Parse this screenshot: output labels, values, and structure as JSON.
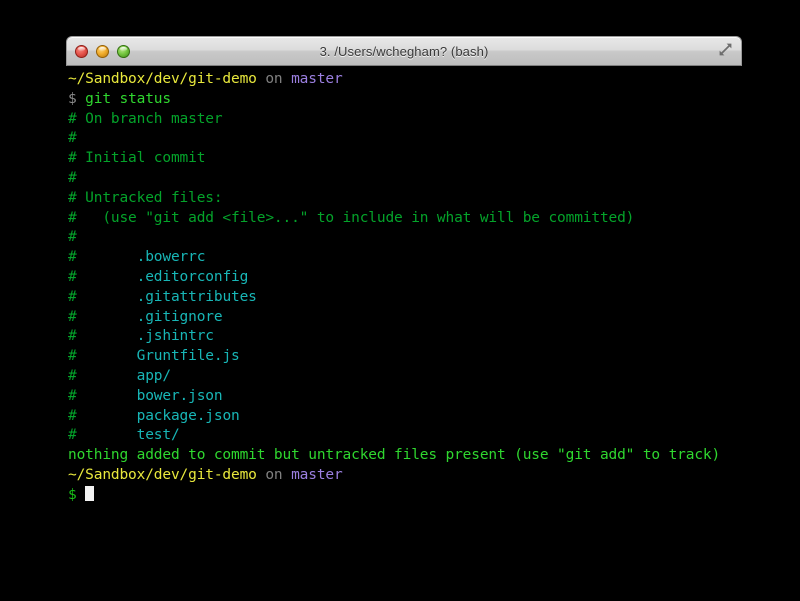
{
  "window": {
    "title": "3. /Users/wchegham? (bash)",
    "traffic_lights": [
      {
        "name": "close",
        "color": "#e8584f"
      },
      {
        "name": "minimize",
        "color": "#f2ae2e"
      },
      {
        "name": "zoom",
        "color": "#78c942"
      }
    ],
    "fullscreen_icon": "expand-diagonal-arrows-icon"
  },
  "colors": {
    "background": "#000000",
    "prompt_path": "#e8e83c",
    "prompt_on": "#808080",
    "prompt_branch": "#9b7fe0",
    "command": "#2fd72f",
    "git_output": "#04a32a",
    "untracked_file": "#18b6b6",
    "status_line": "#2fd72f",
    "cursor": "#f2f2f2"
  },
  "terminal": {
    "prompt_top": {
      "path": "~/Sandbox/dev/git-demo",
      "on": " on ",
      "branch": "master"
    },
    "command_line": {
      "symbol": "$ ",
      "command": "git status"
    },
    "git_output_lines": [
      "# On branch master",
      "#",
      "# Initial commit",
      "#",
      "# Untracked files:",
      "#   (use \"git add <file>...\" to include in what will be committed)",
      "#"
    ],
    "untracked_files": [
      ".bowerrc",
      ".editorconfig",
      ".gitattributes",
      ".gitignore",
      ".jshintrc",
      "Gruntfile.js",
      "app/",
      "bower.json",
      "package.json",
      "test/"
    ],
    "untracked_prefix": "#       ",
    "status_line": "nothing added to commit but untracked files present (use \"git add\" to track)",
    "prompt_bottom": {
      "path": "~/Sandbox/dev/git-demo",
      "on": " on ",
      "branch": "master"
    },
    "final_prompt_symbol": "$ "
  }
}
